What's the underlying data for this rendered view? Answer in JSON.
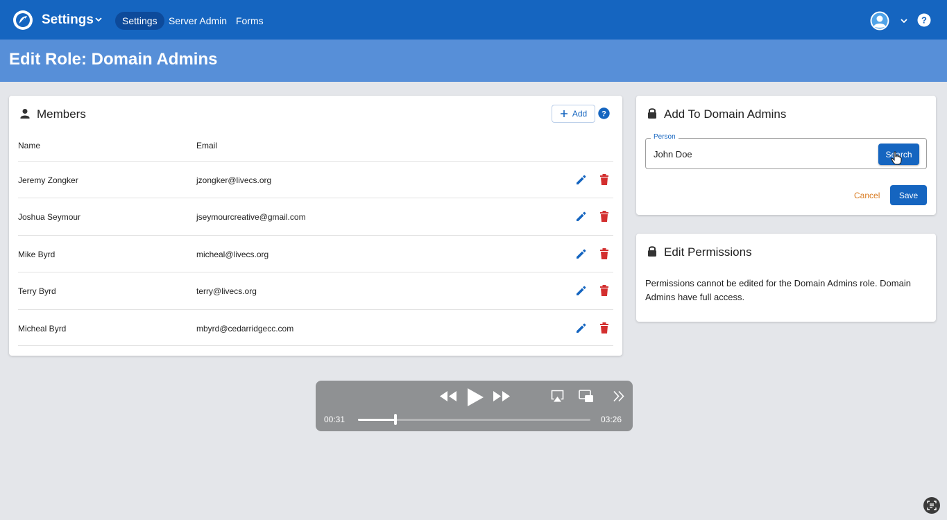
{
  "header": {
    "app_title": "Settings",
    "nav": [
      {
        "label": "Settings",
        "active": true
      },
      {
        "label": "Server Admin",
        "active": false
      },
      {
        "label": "Forms",
        "active": false
      }
    ],
    "icons": [
      "logo-icon",
      "chevron-down-icon",
      "avatar-icon",
      "help-icon"
    ]
  },
  "page": {
    "title": "Edit Role: Domain Admins"
  },
  "members": {
    "title": "Members",
    "add_label": "Add",
    "columns": {
      "name": "Name",
      "email": "Email"
    },
    "rows": [
      {
        "name": "Jeremy Zongker",
        "email": "jzongker@livecs.org"
      },
      {
        "name": "Joshua Seymour",
        "email": "jseymourcreative@gmail.com"
      },
      {
        "name": "Mike Byrd",
        "email": "micheal@livecs.org"
      },
      {
        "name": "Terry Byrd",
        "email": "terry@livecs.org"
      },
      {
        "name": "Micheal Byrd",
        "email": "mbyrd@cedarridgecc.com"
      }
    ]
  },
  "add_to": {
    "title": "Add To Domain Admins",
    "person_label": "Person",
    "person_value": "John Doe",
    "search_label": "Search",
    "cancel_label": "Cancel",
    "save_label": "Save"
  },
  "permissions": {
    "title": "Edit Permissions",
    "text": "Permissions cannot be edited for the Domain Admins role. Domain Admins have full access."
  },
  "player": {
    "elapsed": "00:31",
    "duration": "03:26",
    "progress": 0.16
  },
  "colors": {
    "primary": "#1565c0",
    "header_band": "#578fd8",
    "delete": "#d32f2f",
    "cancel": "#d97b21",
    "background": "#e4e6ea"
  }
}
